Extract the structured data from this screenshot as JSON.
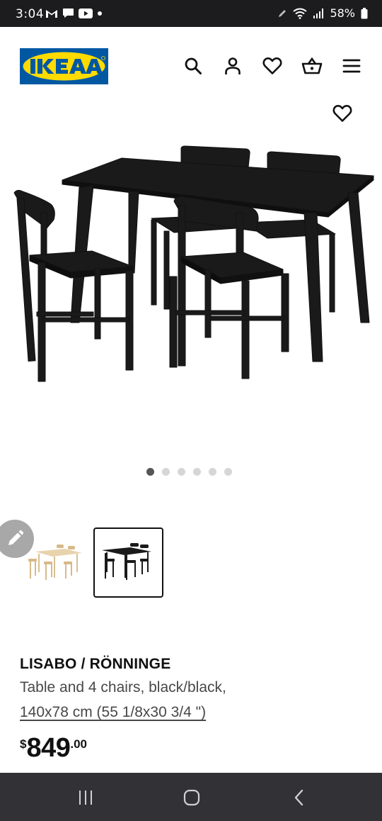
{
  "status_bar": {
    "time": "3:04",
    "battery": "58%",
    "left_icons": [
      "gmail-icon",
      "chat-icon",
      "youtube-icon",
      "dot-icon"
    ],
    "right_icons": [
      "pen-icon",
      "wifi-icon",
      "signal-icon",
      "battery-icon"
    ]
  },
  "header": {
    "logo_text": "IKEA",
    "brand_colors": {
      "blue": "#0058A3",
      "yellow": "#FFDB00"
    },
    "icons": [
      "search-icon",
      "account-icon",
      "heart-icon",
      "basket-icon",
      "menu-icon"
    ]
  },
  "gallery": {
    "total_images": 6,
    "active_index": 0,
    "thumbnails": [
      {
        "name": "white-birch-variant",
        "selected": false
      },
      {
        "name": "black-variant",
        "selected": true
      }
    ]
  },
  "product": {
    "name": "LISABO / RÖNNINGE",
    "description": "Table and 4 chairs, black/black,",
    "size": "140x78 cm (55 1/8x30 3/4 \")",
    "price": {
      "currency": "$",
      "integer": "849",
      "decimal": ".00"
    }
  },
  "nav_bar": {
    "buttons": [
      "recent-apps-icon",
      "home-icon",
      "back-icon"
    ]
  }
}
